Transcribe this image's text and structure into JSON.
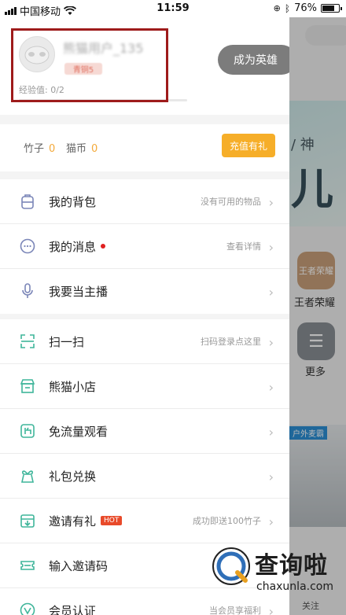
{
  "status_bar": {
    "carrier": "中国移动",
    "time": "11:59",
    "battery": "76%",
    "battery_level": 0.76
  },
  "profile": {
    "username": "熊猫用户_135",
    "level_badge": "青铜5",
    "exp_label": "经验值: 0/2",
    "exp_progress": 0,
    "hero_button": "成为英雄"
  },
  "wallet": {
    "bamboo_label": "竹子",
    "bamboo_value": "0",
    "coin_label": "猫币",
    "coin_value": "0",
    "recharge_button": "充值有礼"
  },
  "menu_group1": [
    {
      "label": "我的背包",
      "hint": "没有可用的物品",
      "icon": "backpack-icon"
    },
    {
      "label": "我的消息",
      "hint": "查看详情",
      "icon": "message-icon",
      "unread_dot": true
    },
    {
      "label": "我要当主播",
      "hint": "",
      "icon": "microphone-icon"
    }
  ],
  "menu_group2": [
    {
      "label": "扫一扫",
      "hint": "扫码登录点这里",
      "icon": "scan-icon"
    },
    {
      "label": "熊猫小店",
      "hint": "",
      "icon": "shop-icon"
    },
    {
      "label": "免流量观看",
      "hint": "",
      "icon": "free-data-icon"
    },
    {
      "label": "礼包兑换",
      "hint": "",
      "icon": "gift-icon"
    },
    {
      "label": "邀请有礼",
      "hint": "成功即送100竹子",
      "icon": "invite-icon",
      "badge": "HOT"
    },
    {
      "label": "输入邀请码",
      "hint": "",
      "icon": "ticket-icon"
    },
    {
      "label": "会员认证",
      "hint": "当会员享福利",
      "icon": "vip-icon"
    }
  ],
  "background": {
    "banner_text": "/ 神",
    "banner_char": "儿",
    "game_label": "王者荣耀",
    "game_icon_text": "王者荣耀",
    "more_label": "更多",
    "card_tag": "户外麦霸",
    "follow_label": "关注"
  },
  "watermark": {
    "name": "查询啦",
    "url": "chaxunla.com"
  },
  "colors": {
    "accent_green": "#3fb59a",
    "accent_orange": "#f6ae29",
    "highlight_red": "#9e1b1b"
  }
}
